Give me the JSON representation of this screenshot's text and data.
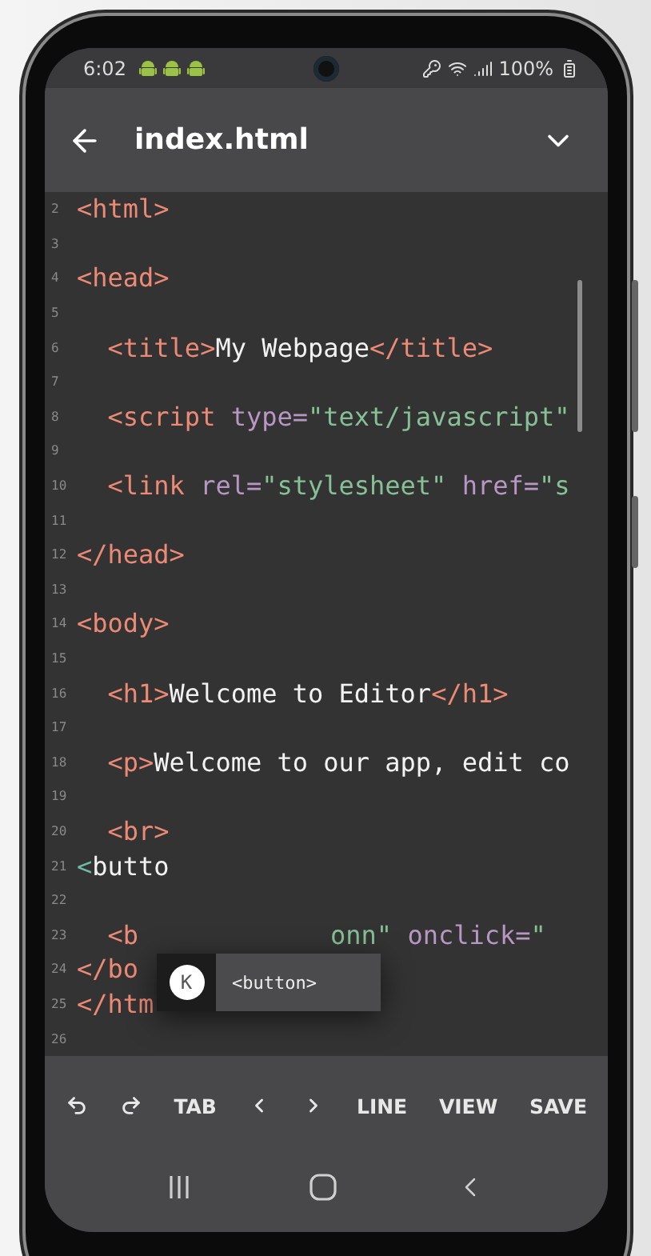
{
  "status_bar": {
    "time": "6:02",
    "battery": "100%"
  },
  "app_bar": {
    "title": "index.html"
  },
  "code_lines": [
    {
      "number": "2",
      "tokens": [
        {
          "kind": "tag",
          "text": "<html>"
        }
      ]
    },
    {
      "number": "3"
    },
    {
      "number": "4",
      "tokens": [
        {
          "kind": "tag",
          "text": "<head>"
        }
      ]
    },
    {
      "number": "5"
    },
    {
      "number": "6",
      "tokens": [
        {
          "kind": "tag",
          "text": "  <title>"
        },
        {
          "kind": "text",
          "text": "My Webpage"
        },
        {
          "kind": "tag",
          "text": "</title>"
        }
      ]
    },
    {
      "number": "7"
    },
    {
      "number": "8",
      "tokens": [
        {
          "kind": "tag",
          "text": "  <script "
        },
        {
          "kind": "attr",
          "text": "type="
        },
        {
          "kind": "string",
          "text": "\"text/javascript\""
        }
      ]
    },
    {
      "number": "9"
    },
    {
      "number": "10",
      "tokens": [
        {
          "kind": "tag",
          "text": "  <link "
        },
        {
          "kind": "attr",
          "text": "rel="
        },
        {
          "kind": "string",
          "text": "\"stylesheet\" "
        },
        {
          "kind": "attr",
          "text": "href="
        },
        {
          "kind": "string",
          "text": "\"s"
        }
      ]
    },
    {
      "number": "11"
    },
    {
      "number": "12",
      "tokens": [
        {
          "kind": "tag",
          "text": "</head>"
        }
      ]
    },
    {
      "number": "13"
    },
    {
      "number": "14",
      "tokens": [
        {
          "kind": "tag",
          "text": "<body>"
        }
      ]
    },
    {
      "number": "15"
    },
    {
      "number": "16",
      "tokens": [
        {
          "kind": "tag",
          "text": "  <h1>"
        },
        {
          "kind": "text",
          "text": "Welcome to Editor"
        },
        {
          "kind": "tag",
          "text": "</h1>"
        }
      ]
    },
    {
      "number": "17"
    },
    {
      "number": "18",
      "tokens": [
        {
          "kind": "tag",
          "text": "  <p>"
        },
        {
          "kind": "text",
          "text": "Welcome to our app, edit co"
        }
      ]
    },
    {
      "number": "19"
    },
    {
      "number": "20",
      "tokens": [
        {
          "kind": "tag",
          "text": "  <br>"
        }
      ]
    },
    {
      "number": "21",
      "tokens": [
        {
          "kind": "open",
          "text": "<"
        },
        {
          "kind": "text",
          "text": "butto"
        }
      ]
    },
    {
      "number": "22"
    },
    {
      "number": "23",
      "tokens": [
        {
          "kind": "tag",
          "text": "  <b"
        }
      ],
      "after_popup": [
        {
          "kind": "string",
          "text": "onn\" "
        },
        {
          "kind": "attr",
          "text": "onclick="
        },
        {
          "kind": "string",
          "text": "\""
        }
      ]
    },
    {
      "number": "24",
      "tokens": [
        {
          "kind": "tag",
          "text": "</bo"
        }
      ]
    },
    {
      "number": "25",
      "tokens": [
        {
          "kind": "tag",
          "text": "</htm"
        }
      ]
    },
    {
      "number": "26"
    }
  ],
  "suggestion_popup": {
    "badge": "K",
    "label": "<button>"
  },
  "toolbar": [
    {
      "kind": "undo"
    },
    {
      "kind": "redo"
    },
    {
      "kind": "label",
      "label": "TAB"
    },
    {
      "kind": "left"
    },
    {
      "kind": "right"
    },
    {
      "kind": "label",
      "label": "LINE"
    },
    {
      "kind": "label",
      "label": "VIEW"
    },
    {
      "kind": "label",
      "label": "SAVE"
    }
  ]
}
